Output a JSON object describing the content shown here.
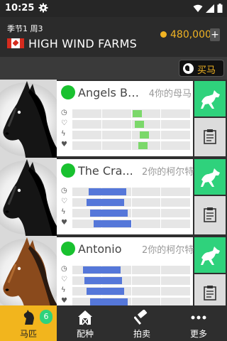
{
  "status_bar": {
    "time": "10:25",
    "icons": [
      "gear-icon",
      "wifi-icon",
      "signal-icon",
      "battery-icon"
    ]
  },
  "header": {
    "season": "季节1 周3",
    "flag": "canada-flag",
    "farm_name": "HIGH WIND FARMS",
    "money": "480,000",
    "add_money_label": "+"
  },
  "toolbar": {
    "buy_label": "买马"
  },
  "colors": {
    "accent_green": "#2fd27c",
    "status_green": "#19c12f",
    "bar_green": "#7bd86a",
    "bar_blue": "#5577d9",
    "gold": "#f0b323",
    "nav_active": "#f2b51d"
  },
  "stat_icons": [
    "clock-icon",
    "heart-rate-icon",
    "lightning-icon",
    "heart-icon"
  ],
  "horses": [
    {
      "name": "Angels Br...",
      "meta": "4你的母马",
      "coat": "black",
      "bar_color": "green",
      "stats": [
        {
          "start": 0.51,
          "end": 0.59
        },
        {
          "start": 0.53,
          "end": 0.61
        },
        {
          "start": 0.57,
          "end": 0.65
        },
        {
          "start": 0.56,
          "end": 0.64
        }
      ]
    },
    {
      "name": "The Cra...",
      "meta": "2你的柯尔特",
      "coat": "black",
      "bar_color": "blue",
      "stats": [
        {
          "start": 0.14,
          "end": 0.46
        },
        {
          "start": 0.12,
          "end": 0.44
        },
        {
          "start": 0.15,
          "end": 0.47
        },
        {
          "start": 0.18,
          "end": 0.5
        }
      ]
    },
    {
      "name": "Antonio",
      "meta": "2你的柯尔特",
      "coat": "bay",
      "bar_color": "blue",
      "stats": [
        {
          "start": 0.09,
          "end": 0.41
        },
        {
          "start": 0.1,
          "end": 0.42
        },
        {
          "start": 0.12,
          "end": 0.44
        },
        {
          "start": 0.15,
          "end": 0.47
        }
      ]
    }
  ],
  "bottom_nav": [
    {
      "label": "马匹",
      "icon": "horse-head-icon",
      "badge": "6",
      "active": true
    },
    {
      "label": "配种",
      "icon": "barn-icon",
      "active": false
    },
    {
      "label": "拍卖",
      "icon": "gavel-icon",
      "active": false
    },
    {
      "label": "更多",
      "icon": "more-dots-icon",
      "active": false
    }
  ]
}
